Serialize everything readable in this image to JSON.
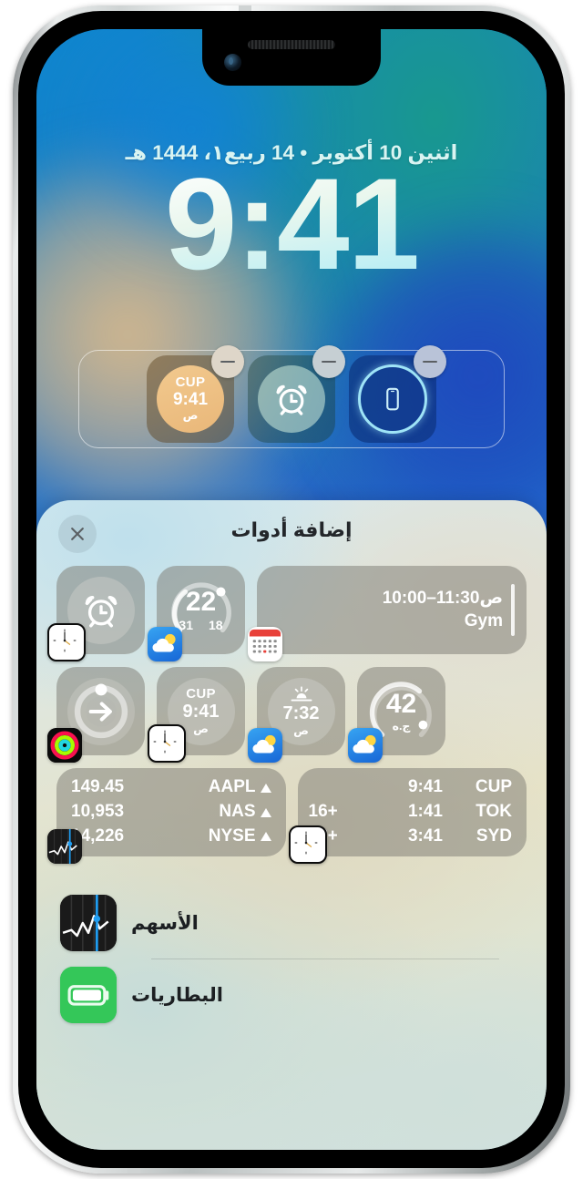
{
  "lockscreen": {
    "date": "اثنين 10 أكتوبر • 14 ربيع١، 1444 هـ",
    "time": "9:41",
    "widgets": [
      {
        "name": "world-clock-cupertino",
        "line1": "CUP",
        "line2": "9:41",
        "line3": "ص",
        "remove_label": "−"
      },
      {
        "name": "alarm",
        "icon": "alarm-clock-icon",
        "remove_label": "−"
      },
      {
        "name": "find-my-phone",
        "icon": "find-my-phone-icon",
        "remove_label": "−"
      }
    ]
  },
  "sheet": {
    "title": "إضافة أدوات",
    "close_label": "×",
    "rows": [
      {
        "cards": [
          {
            "type": "alarm",
            "badge": "clock-app-icon"
          },
          {
            "type": "weather-temp",
            "value": "22",
            "high": "31",
            "low": "18",
            "badge": "weather-app-icon"
          },
          {
            "type": "calendar-event",
            "time": "10:00–11:30ص",
            "event": "Gym",
            "badge": "calendar-app-icon"
          }
        ]
      },
      {
        "cards": [
          {
            "type": "fitness-rings",
            "badge": "fitness-app-icon"
          },
          {
            "type": "world-clock-single",
            "line1": "CUP",
            "line2": "9:41",
            "line3": "ص",
            "badge": "clock-app-icon"
          },
          {
            "type": "sunrise",
            "line2": "7:32",
            "line3": "ص",
            "badge": "weather-app-icon"
          },
          {
            "type": "air-quality",
            "value": "42",
            "unit": "ج.ه",
            "badge": "weather-app-icon"
          }
        ]
      },
      {
        "cards": [
          {
            "type": "stocks-list",
            "badge": "stocks-app-icon",
            "rows": [
              {
                "value": "149.45",
                "symbol": "AAPL",
                "trend": "up"
              },
              {
                "value": "10,953",
                "symbol": "NAS",
                "trend": "up"
              },
              {
                "value": "14,226",
                "symbol": "NYSE",
                "trend": "up"
              }
            ]
          },
          {
            "type": "world-clock-list",
            "badge": "clock-app-icon",
            "rows": [
              {
                "offset": "",
                "time": "9:41",
                "city": "CUP"
              },
              {
                "offset": "16+",
                "time": "1:41",
                "city": "TOK"
              },
              {
                "offset": "18+",
                "time": "3:41",
                "city": "SYD"
              }
            ]
          }
        ]
      }
    ],
    "apps": [
      {
        "name": "الأسهم",
        "icon": "stocks-app-icon"
      },
      {
        "name": "البطاريات",
        "icon": "batteries-app-icon"
      }
    ]
  },
  "colors": {
    "accent": "#34c759",
    "stocks_line": "#1f9cf0",
    "calendar_red": "#e8413a",
    "find_my_ring": "#9fe4f7"
  }
}
